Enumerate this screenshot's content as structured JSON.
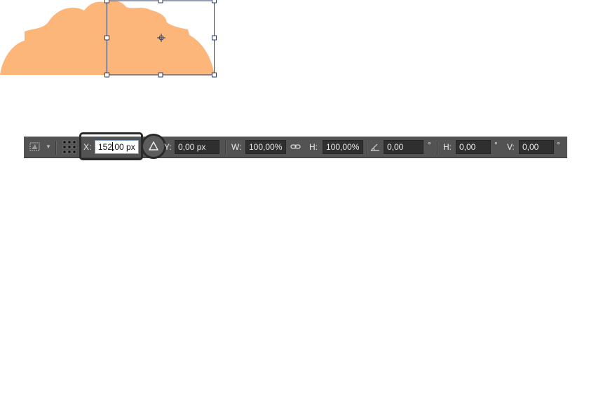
{
  "canvas": {
    "shape_color": "#fdb67a",
    "selection_color": "#2a3b66"
  },
  "options_bar": {
    "tool_icon": "transform-tool-icon",
    "reference_grid_icon": "reference-point-grid-icon",
    "x": {
      "label": "X:",
      "value_left": "152",
      "value_right": ",00 px"
    },
    "relative_icon": "triangle-relative-positioning-icon",
    "y": {
      "label": "Y:",
      "value": "0,00 px"
    },
    "w": {
      "label": "W:",
      "value": "100,00%"
    },
    "link_icon": "chain-link-icon",
    "h": {
      "label": "H:",
      "value": "100,00%"
    },
    "rotate": {
      "icon": "angle-icon",
      "value": "0,00",
      "unit": "°"
    },
    "skew_h": {
      "label": "H:",
      "value": "0,00",
      "unit": "°"
    },
    "skew_v": {
      "label": "V:",
      "value": "0,00",
      "unit": "°"
    },
    "colors": {
      "bar": "#535353",
      "field": "#2f2f2f"
    }
  }
}
